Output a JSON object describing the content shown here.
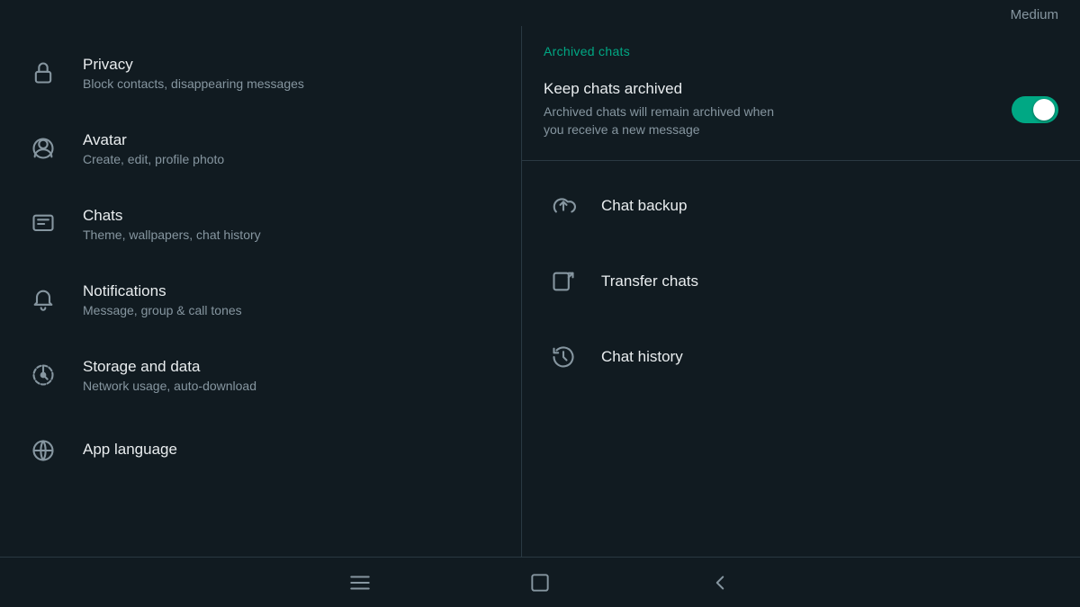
{
  "header": {
    "medium_label": "Medium"
  },
  "left_panel": {
    "items": [
      {
        "id": "privacy",
        "title": "Privacy",
        "subtitle": "Block contacts, disappearing messages",
        "icon": "lock-icon"
      },
      {
        "id": "avatar",
        "title": "Avatar",
        "subtitle": "Create, edit, profile photo",
        "icon": "avatar-icon"
      },
      {
        "id": "chats",
        "title": "Chats",
        "subtitle": "Theme, wallpapers, chat history",
        "icon": "chat-icon"
      },
      {
        "id": "notifications",
        "title": "Notifications",
        "subtitle": "Message, group & call tones",
        "icon": "bell-icon"
      },
      {
        "id": "storage",
        "title": "Storage and data",
        "subtitle": "Network usage, auto-download",
        "icon": "storage-icon"
      },
      {
        "id": "language",
        "title": "App language",
        "subtitle": "",
        "icon": "language-icon"
      }
    ]
  },
  "right_panel": {
    "archived_chats_label": "Archived chats",
    "keep_archived": {
      "title": "Keep chats archived",
      "description": "Archived chats will remain archived when you receive a new message",
      "toggle_on": true
    },
    "actions": [
      {
        "id": "chat-backup",
        "label": "Chat backup",
        "icon": "cloud-upload-icon"
      },
      {
        "id": "transfer-chats",
        "label": "Transfer chats",
        "icon": "transfer-icon"
      },
      {
        "id": "chat-history",
        "label": "Chat history",
        "icon": "history-icon"
      }
    ]
  },
  "bottom_nav": {
    "items": [
      {
        "id": "menu",
        "icon": "hamburger-icon"
      },
      {
        "id": "home",
        "icon": "square-icon"
      },
      {
        "id": "back",
        "icon": "back-icon"
      }
    ]
  }
}
